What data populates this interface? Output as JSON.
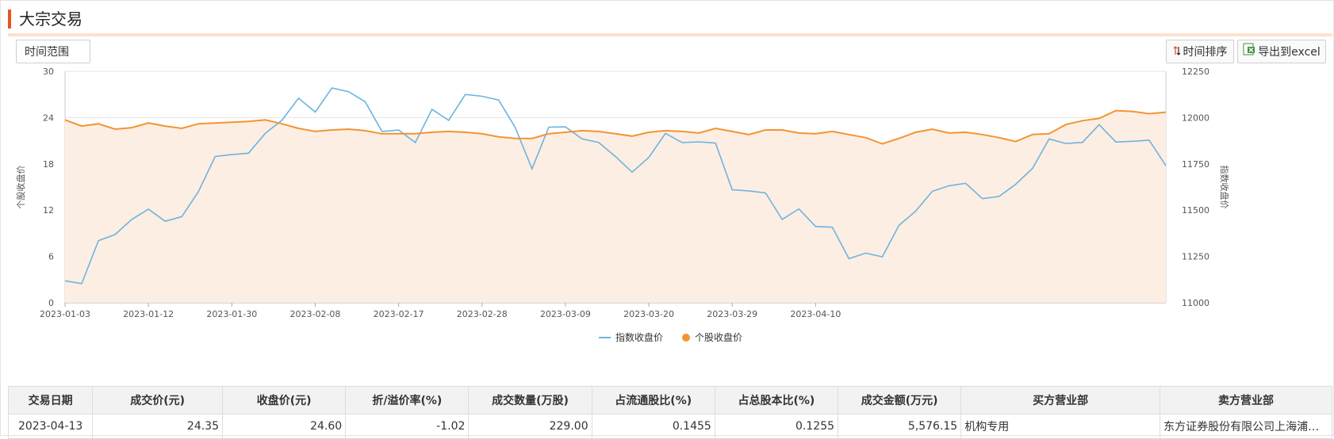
{
  "header": {
    "title": "大宗交易"
  },
  "toolbar": {
    "range_label": "时间范围",
    "sort_label": "时间排序",
    "excel_label": "导出到excel"
  },
  "chart_data": {
    "type": "line",
    "x_tick_labels": [
      "2023-01-03",
      "2023-01-12",
      "2023-01-30",
      "2023-02-08",
      "2023-02-17",
      "2023-02-28",
      "2023-03-09",
      "2023-03-20",
      "2023-03-29",
      "2023-04-10"
    ],
    "x_tick_indices": [
      0,
      5,
      10,
      15,
      20,
      25,
      30,
      35,
      40,
      45
    ],
    "y_left_label": "个股收盘价",
    "y_left_ticks": [
      0,
      6,
      12,
      18,
      24,
      30
    ],
    "y_left_lim": [
      0,
      30
    ],
    "y_right_label": "指数收盘价",
    "y_right_ticks": [
      11000,
      11250,
      11500,
      11750,
      12000,
      12250
    ],
    "y_right_lim": [
      11000,
      12250
    ],
    "legend_position": "bottom",
    "grid": true,
    "series": [
      {
        "name": "指数收盘价",
        "axis": "right",
        "color": "#6cb4e0",
        "values": [
          11118,
          11103,
          11335,
          11368,
          11450,
          11505,
          11440,
          11465,
          11600,
          11790,
          11800,
          11808,
          11915,
          11985,
          12105,
          12030,
          12160,
          12140,
          12085,
          11925,
          11933,
          11865,
          12045,
          11985,
          12125,
          12115,
          12095,
          11945,
          11723,
          11948,
          11950,
          11885,
          11865,
          11790,
          11705,
          11785,
          11915,
          11865,
          11869,
          11862,
          11610,
          11604,
          11593,
          11450,
          11507,
          11412,
          11408,
          11238,
          11268,
          11248,
          11418,
          11495,
          11602,
          11632,
          11645,
          11562,
          11574,
          11640,
          11725,
          11885,
          11860,
          11866,
          11962,
          11868,
          11872,
          11878,
          11740
        ]
      },
      {
        "name": "个股收盘价",
        "axis": "left",
        "color": "#f39433",
        "values": [
          23.7,
          22.9,
          23.2,
          22.5,
          22.7,
          23.3,
          22.9,
          22.6,
          23.2,
          23.3,
          23.4,
          23.5,
          23.7,
          23.2,
          22.6,
          22.2,
          22.4,
          22.5,
          22.3,
          21.9,
          21.9,
          21.9,
          22.1,
          22.2,
          22.1,
          21.9,
          21.5,
          21.3,
          21.3,
          21.9,
          22.1,
          22.3,
          22.2,
          21.9,
          21.6,
          22.1,
          22.3,
          22.2,
          22.0,
          22.6,
          22.2,
          21.8,
          22.4,
          22.4,
          22.0,
          21.9,
          22.2,
          21.8,
          21.4,
          20.6,
          21.3,
          22.1,
          22.5,
          22.0,
          22.1,
          21.8,
          21.4,
          20.9,
          21.8,
          21.9,
          23.1,
          23.6,
          23.9,
          24.9,
          24.8,
          24.5,
          24.7
        ]
      }
    ]
  },
  "table": {
    "headers": [
      "交易日期",
      "成交价(元)",
      "收盘价(元)",
      "折/溢价率(%)",
      "成交数量(万股)",
      "占流通股比(%)",
      "占总股本比(%)",
      "成交金额(万元)",
      "买方营业部",
      "卖方营业部"
    ],
    "rows": [
      [
        "2023-04-13",
        "24.35",
        "24.60",
        "-1.02",
        "229.00",
        "0.1455",
        "0.1255",
        "5,576.15",
        "机构专用",
        "东方证券股份有限公司上海浦东新区源深路证券营业部"
      ]
    ]
  }
}
